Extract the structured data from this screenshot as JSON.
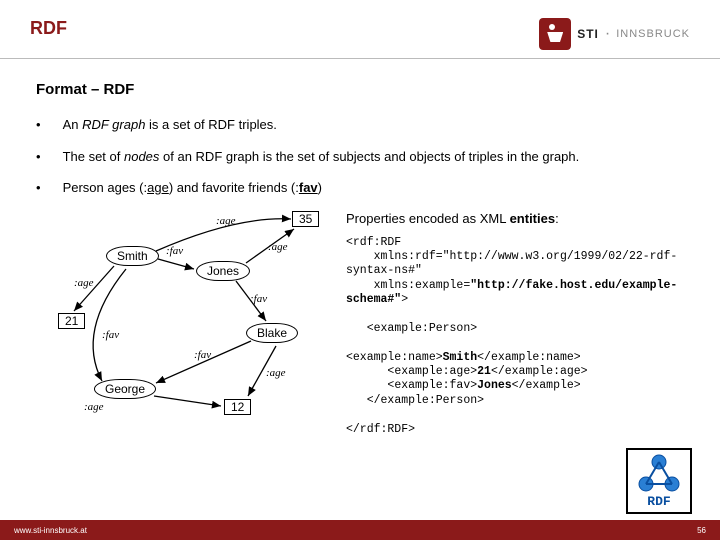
{
  "header": {
    "title": "RDF",
    "brand_bold": "STI",
    "brand_light": "INNSBRUCK"
  },
  "section_title": "Format – RDF",
  "bullets": {
    "b1_pre": "An ",
    "b1_em": "RDF graph",
    "b1_post": " is a set of RDF triples.",
    "b2_pre": "The set of ",
    "b2_em": "nodes",
    "b2_post": " of an RDF graph is the set of subjects and objects of triples in the graph.",
    "b3_pre": "Person ages (:",
    "b3_u1": "age",
    "b3_mid": ") and favorite friends (:",
    "b3_u2": "fav",
    "b3_post": ")"
  },
  "graph": {
    "smith": "Smith",
    "jones": "Jones",
    "blake": "Blake",
    "george": "George",
    "v35": "35",
    "v21": "21",
    "v12": "12",
    "fav": ":fav",
    "age": ":age"
  },
  "xml_note_pre": "Properties encoded as XML ",
  "xml_note_b": "entities",
  "xml_note_post": ":",
  "code": {
    "l1": "<rdf:RDF",
    "l2": "    xmlns:rdf=\"http://www.w3.org/1999/02/22-rdf-syntax-ns#\"",
    "l3a": "    xmlns:example=",
    "l3b": "\"http://fake.host.edu/example-schema#\"",
    "l3c": ">",
    "l4": "   <example:Person>",
    "l5a": "<example:name>",
    "l5b": "Smith",
    "l5c": "</example:name>",
    "l6a": "      <example:age>",
    "l6b": "21",
    "l6c": "</example:age>",
    "l7a": "      <example:fav>",
    "l7b": "Jones",
    "l7c": "</example>",
    "l8": "   </example:Person>",
    "l9": "</rdf:RDF>"
  },
  "badge": "RDF",
  "footer": {
    "url": "www.sti-innsbruck.at",
    "page": "56"
  }
}
